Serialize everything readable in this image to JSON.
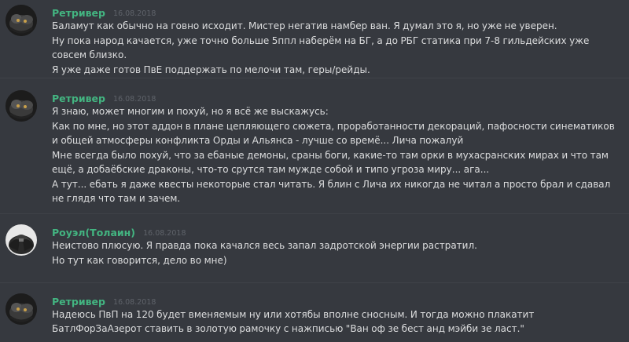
{
  "messages": [
    {
      "author": "Ретривер",
      "timestamp": "16.08.2018",
      "avatar_icon": "dark-creature-avatar-icon",
      "lines": [
        "Баламут как обычно на говно исходит. Мистер негатив намбер ван. Я думал это я, но уже не уверен.",
        "Ну пока народ качается, уже точно больше 5ппл наберём на БГ, а до РБГ статика при 7-8 гильдейских уже совсем близко.",
        "Я уже даже готов ПвЕ поддержать по мелочи там, геры/рейды."
      ]
    },
    {
      "author": "Ретривер",
      "timestamp": "16.08.2018",
      "avatar_icon": "dark-creature-avatar-icon",
      "lines": [
        "Я знаю, может многим и похуй, но я всё же выскажусь:",
        "Как по мне, но этот аддон в плане цепляющего сюжета, проработанности декораций, пафосности синематиков и общей атмосферы конфликта Орды и Альянса - лучше со времё... Лича пожалуй",
        "Мне всегда было похуй, что за ебаные демоны, сраны боги, какие-то там орки в мухасранских мирах и что там ещё, а добаёбские драконы, что-то срутся там мужде собой и типо угроза миру... ага...",
        "А тут... ебать я даже квесты некоторые стал читать. Я блин с Лича их никогда не читал а просто брал и сдавал не глядя что там и зачем."
      ]
    },
    {
      "author": "Роуэл(Толаин)",
      "timestamp": "16.08.2018",
      "avatar_icon": "armored-warrior-avatar-icon",
      "lines": [
        "Неистово плюсую. Я правда пока качался весь запал задротской энергии растратил.",
        "Но тут как говорится, дело во мне)"
      ]
    },
    {
      "author": "Ретривер",
      "timestamp": "16.08.2018",
      "avatar_icon": "dark-creature-avatar-icon",
      "lines": [
        "Надеюсь ПвП на 120 будет вменяемым ну или хотябы вполне сносным. И тогда можно плакатит БатлФорЗаАзерот ставить в золотую рамочку с нажписью \"Ван оф зе бест анд мэйби зе ласт.\""
      ]
    }
  ],
  "colors": {
    "background": "#36393f",
    "author_name": "#43b581",
    "message_text": "#dcddde",
    "timestamp": "#72767d",
    "divider": "#3f4248"
  }
}
